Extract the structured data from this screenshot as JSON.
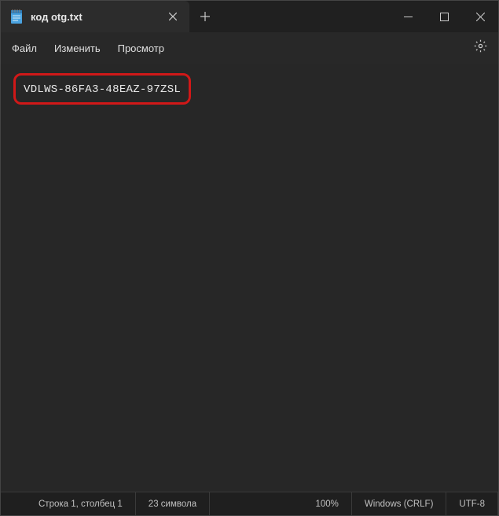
{
  "tab": {
    "title": "код otg.txt"
  },
  "menu": {
    "file": "Файл",
    "edit": "Изменить",
    "view": "Просмотр"
  },
  "editor": {
    "content": "VDLWS-86FA3-48EAZ-97ZSL"
  },
  "statusbar": {
    "position": "Строка 1, столбец 1",
    "charcount": "23 символа",
    "zoom": "100%",
    "lineending": "Windows (CRLF)",
    "encoding": "UTF-8"
  }
}
